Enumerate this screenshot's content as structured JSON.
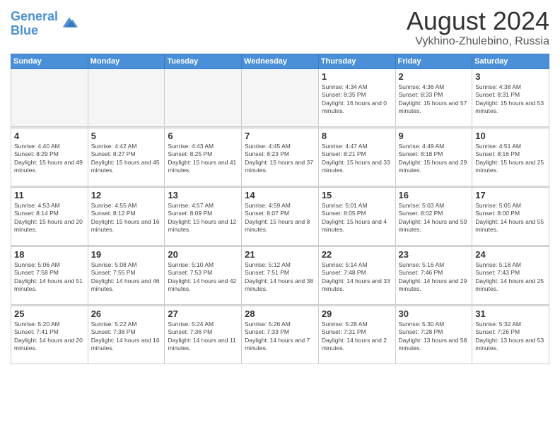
{
  "logo": {
    "line1": "General",
    "line2": "Blue"
  },
  "title": "August 2024",
  "location": "Vykhino-Zhulebino, Russia",
  "days_of_week": [
    "Sunday",
    "Monday",
    "Tuesday",
    "Wednesday",
    "Thursday",
    "Friday",
    "Saturday"
  ],
  "weeks": [
    [
      {
        "day": "",
        "info": ""
      },
      {
        "day": "",
        "info": ""
      },
      {
        "day": "",
        "info": ""
      },
      {
        "day": "",
        "info": ""
      },
      {
        "day": "1",
        "sunrise": "4:34 AM",
        "sunset": "8:35 PM",
        "daylight": "16 hours and 0 minutes."
      },
      {
        "day": "2",
        "sunrise": "4:36 AM",
        "sunset": "8:33 PM",
        "daylight": "15 hours and 57 minutes."
      },
      {
        "day": "3",
        "sunrise": "4:38 AM",
        "sunset": "8:31 PM",
        "daylight": "15 hours and 53 minutes."
      }
    ],
    [
      {
        "day": "4",
        "sunrise": "4:40 AM",
        "sunset": "8:29 PM",
        "daylight": "15 hours and 49 minutes."
      },
      {
        "day": "5",
        "sunrise": "4:42 AM",
        "sunset": "8:27 PM",
        "daylight": "15 hours and 45 minutes."
      },
      {
        "day": "6",
        "sunrise": "4:43 AM",
        "sunset": "8:25 PM",
        "daylight": "15 hours and 41 minutes."
      },
      {
        "day": "7",
        "sunrise": "4:45 AM",
        "sunset": "8:23 PM",
        "daylight": "15 hours and 37 minutes."
      },
      {
        "day": "8",
        "sunrise": "4:47 AM",
        "sunset": "8:21 PM",
        "daylight": "15 hours and 33 minutes."
      },
      {
        "day": "9",
        "sunrise": "4:49 AM",
        "sunset": "8:18 PM",
        "daylight": "15 hours and 29 minutes."
      },
      {
        "day": "10",
        "sunrise": "4:51 AM",
        "sunset": "8:16 PM",
        "daylight": "15 hours and 25 minutes."
      }
    ],
    [
      {
        "day": "11",
        "sunrise": "4:53 AM",
        "sunset": "8:14 PM",
        "daylight": "15 hours and 20 minutes."
      },
      {
        "day": "12",
        "sunrise": "4:55 AM",
        "sunset": "8:12 PM",
        "daylight": "15 hours and 16 minutes."
      },
      {
        "day": "13",
        "sunrise": "4:57 AM",
        "sunset": "8:09 PM",
        "daylight": "15 hours and 12 minutes."
      },
      {
        "day": "14",
        "sunrise": "4:59 AM",
        "sunset": "8:07 PM",
        "daylight": "15 hours and 8 minutes."
      },
      {
        "day": "15",
        "sunrise": "5:01 AM",
        "sunset": "8:05 PM",
        "daylight": "15 hours and 4 minutes."
      },
      {
        "day": "16",
        "sunrise": "5:03 AM",
        "sunset": "8:02 PM",
        "daylight": "14 hours and 59 minutes."
      },
      {
        "day": "17",
        "sunrise": "5:05 AM",
        "sunset": "8:00 PM",
        "daylight": "14 hours and 55 minutes."
      }
    ],
    [
      {
        "day": "18",
        "sunrise": "5:06 AM",
        "sunset": "7:58 PM",
        "daylight": "14 hours and 51 minutes."
      },
      {
        "day": "19",
        "sunrise": "5:08 AM",
        "sunset": "7:55 PM",
        "daylight": "14 hours and 46 minutes."
      },
      {
        "day": "20",
        "sunrise": "5:10 AM",
        "sunset": "7:53 PM",
        "daylight": "14 hours and 42 minutes."
      },
      {
        "day": "21",
        "sunrise": "5:12 AM",
        "sunset": "7:51 PM",
        "daylight": "14 hours and 38 minutes."
      },
      {
        "day": "22",
        "sunrise": "5:14 AM",
        "sunset": "7:48 PM",
        "daylight": "14 hours and 33 minutes."
      },
      {
        "day": "23",
        "sunrise": "5:16 AM",
        "sunset": "7:46 PM",
        "daylight": "14 hours and 29 minutes."
      },
      {
        "day": "24",
        "sunrise": "5:18 AM",
        "sunset": "7:43 PM",
        "daylight": "14 hours and 25 minutes."
      }
    ],
    [
      {
        "day": "25",
        "sunrise": "5:20 AM",
        "sunset": "7:41 PM",
        "daylight": "14 hours and 20 minutes."
      },
      {
        "day": "26",
        "sunrise": "5:22 AM",
        "sunset": "7:38 PM",
        "daylight": "14 hours and 16 minutes."
      },
      {
        "day": "27",
        "sunrise": "5:24 AM",
        "sunset": "7:36 PM",
        "daylight": "14 hours and 11 minutes."
      },
      {
        "day": "28",
        "sunrise": "5:26 AM",
        "sunset": "7:33 PM",
        "daylight": "14 hours and 7 minutes."
      },
      {
        "day": "29",
        "sunrise": "5:28 AM",
        "sunset": "7:31 PM",
        "daylight": "14 hours and 2 minutes."
      },
      {
        "day": "30",
        "sunrise": "5:30 AM",
        "sunset": "7:28 PM",
        "daylight": "13 hours and 58 minutes."
      },
      {
        "day": "31",
        "sunrise": "5:32 AM",
        "sunset": "7:26 PM",
        "daylight": "13 hours and 53 minutes."
      }
    ]
  ]
}
